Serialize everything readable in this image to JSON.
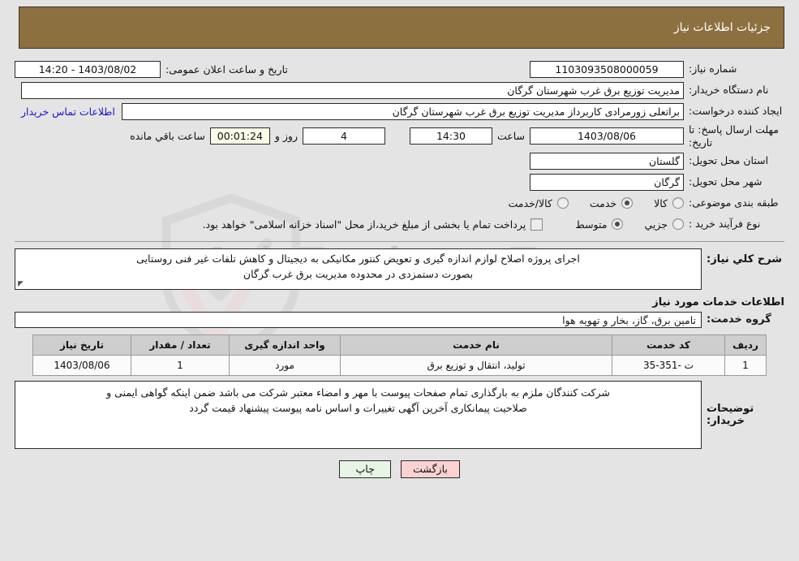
{
  "header": {
    "title": "جزئیات اطلاعات نیاز"
  },
  "form": {
    "need_number_label": "شماره نیاز:",
    "need_number_value": "1103093508000059",
    "public_announce_label": "تاریخ و ساعت اعلان عمومی:",
    "public_announce_value": "1403/08/02 - 14:20",
    "buyer_org_label": "نام دستگاه خریدار:",
    "buyer_org_value": "مدیریت توزیع برق غرب شهرستان گرگان",
    "creator_label": "ایجاد کننده درخواست:",
    "creator_value": "براتعلی زورمرادی کاربرداز مدیریت توزیع برق غرب شهرستان گرگان",
    "contact_link": "اطلاعات تماس خریدار",
    "deadline_label": "مهلت ارسال پاسخ: تا تاریخ:",
    "deadline_date": "1403/08/06",
    "deadline_hour_label": "ساعت",
    "deadline_hour": "14:30",
    "days_value": "4",
    "days_label": "روز و",
    "countdown_value": "00:01:24",
    "countdown_label": "ساعت باقي مانده",
    "province_label": "استان محل تحویل:",
    "province_value": "گلستان",
    "city_label": "شهر محل تحویل:",
    "city_value": "گرگان",
    "category_label": "طبقه بندی موضوعی:",
    "category_options": [
      {
        "label": "کالا",
        "selected": false
      },
      {
        "label": "خدمت",
        "selected": true
      },
      {
        "label": "کالا/خدمت",
        "selected": false
      }
    ],
    "process_label": "نوع فرآیند خرید :",
    "process_options": [
      {
        "label": "جزیي",
        "selected": false
      },
      {
        "label": "متوسط",
        "selected": true
      }
    ],
    "payment_checkbox_label": "پرداخت تمام یا بخشی از مبلغ خرید،از محل \"اسناد خزانه اسلامی\" خواهد بود.",
    "payment_checked": false
  },
  "description": {
    "label": "شرح کلي نیاز:",
    "line1": "اجرای پروژه اصلاح لوازم اندازه گیری و تعویض کنتور مکانیکی به دیجیتال و کاهش تلفات غیر فنی روستایی",
    "line2": "بصورت دستمزدی در محدوده مدیریت برق غرب گرگان"
  },
  "services": {
    "section_title": "اطلاعات خدمات مورد نیاز",
    "group_label": "گروه خدمت:",
    "group_value": "تامین برق، گاز، بخار و تهویه هوا",
    "columns": [
      "ردیف",
      "کد خدمت",
      "نام خدمت",
      "واحد اندازه گیری",
      "تعداد / مقدار",
      "تاریخ نیاز"
    ],
    "rows": [
      {
        "index": "1",
        "code": "ت -351-35",
        "name": "تولید، انتقال و توزیع برق",
        "unit": "مورد",
        "quantity": "1",
        "date": "1403/08/06"
      }
    ]
  },
  "notes": {
    "label": "توضیحات خریدار:",
    "line1": "شرکت کنندگان ملزم به بارگذاری تمام صفحات پیوست با مهر و امضاء معتبر شرکت می باشد ضمن اینکه گواهی ایمنی و",
    "line2": "صلاحیت پیمانکاری آخرین آگهی تغییرات و اساس نامه پیوست پیشنهاد قیمت گردد"
  },
  "buttons": {
    "print": "چاپ",
    "back": "بازگشت"
  },
  "watermark": {
    "text": "AniaTender.neT"
  },
  "colors": {
    "header_bg": "#8d7040",
    "page_bg": "#e4e4e4",
    "link": "#1414cf",
    "print_btn": "#e7f5e4",
    "back_btn": "#fbd2d2",
    "table_header": "#cecece"
  }
}
